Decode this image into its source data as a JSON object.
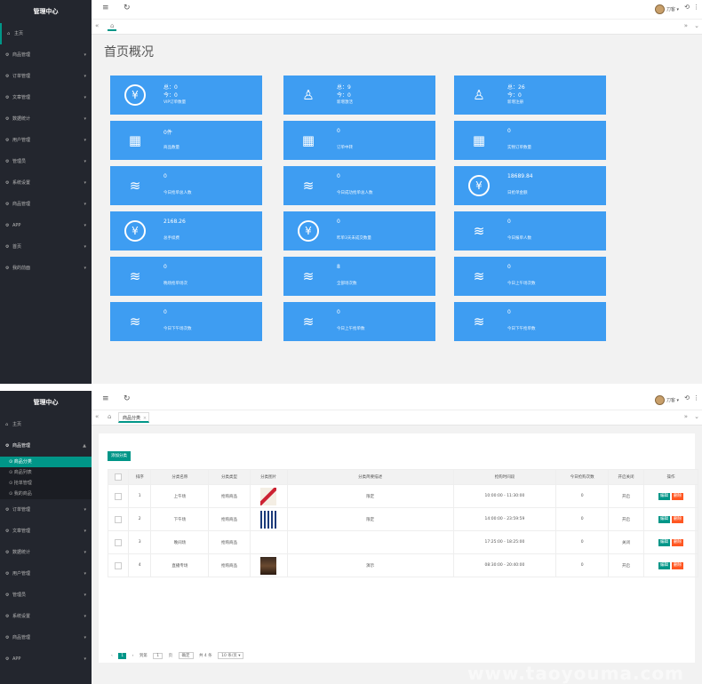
{
  "top_panel": {
    "sidebar_title": "管理中心",
    "menu": [
      {
        "icon": "home-icon",
        "glyph": "⌂",
        "label": "主页",
        "has_arrow": false
      },
      {
        "icon": "gear-icon",
        "glyph": "⚙",
        "label": "商品管理",
        "has_arrow": true
      },
      {
        "icon": "gear-icon",
        "glyph": "⚙",
        "label": "订单管理",
        "has_arrow": true
      },
      {
        "icon": "gear-icon",
        "glyph": "⚙",
        "label": "文章管理",
        "has_arrow": true
      },
      {
        "icon": "gear-icon",
        "glyph": "⚙",
        "label": "数据统计",
        "has_arrow": true
      },
      {
        "icon": "gear-icon",
        "glyph": "⚙",
        "label": "用户管理",
        "has_arrow": true
      },
      {
        "icon": "gear-icon",
        "glyph": "⚙",
        "label": "管理员",
        "has_arrow": true
      },
      {
        "icon": "gear-icon",
        "glyph": "⚙",
        "label": "系统设置",
        "has_arrow": true
      },
      {
        "icon": "gear-icon",
        "glyph": "⚙",
        "label": "商品管理",
        "has_arrow": true
      },
      {
        "icon": "gear-icon",
        "glyph": "⚙",
        "label": "APP",
        "has_arrow": true
      },
      {
        "icon": "gear-icon",
        "glyph": "⚙",
        "label": "首页",
        "has_arrow": true
      },
      {
        "icon": "gear-icon",
        "glyph": "⚙",
        "label": "我的前面",
        "has_arrow": true
      }
    ],
    "username": "刀客",
    "page_title": "首页概况",
    "cards": [
      {
        "icon": "yen-icon",
        "glyph": "¥",
        "circle": true,
        "l1": "总：0",
        "l2": "今：0",
        "l3": "VIP订单数量"
      },
      {
        "icon": "user-icon",
        "glyph": "♙",
        "circle": false,
        "l1": "总：9",
        "l2": "今：0",
        "l3": "新增激活"
      },
      {
        "icon": "user-icon",
        "glyph": "♙",
        "circle": false,
        "l1": "总：26",
        "l2": "今：0",
        "l3": "新增注册"
      },
      {
        "icon": "grid-icon",
        "glyph": "▦",
        "circle": false,
        "l1": "0件",
        "l2": "",
        "l3": "商品数量"
      },
      {
        "icon": "grid-icon",
        "glyph": "▦",
        "circle": false,
        "l1": "0",
        "l2": "",
        "l3": "订单中转"
      },
      {
        "icon": "grid-icon",
        "glyph": "▦",
        "circle": false,
        "l1": "0",
        "l2": "",
        "l3": "实物订单数量"
      },
      {
        "icon": "layers-icon",
        "glyph": "≋",
        "circle": false,
        "l1": "0",
        "l2": "",
        "l3": "今日抢单总人数"
      },
      {
        "icon": "layers-icon",
        "glyph": "≋",
        "circle": false,
        "l1": "0",
        "l2": "",
        "l3": "今日成功抢单总人数"
      },
      {
        "icon": "yen-icon",
        "glyph": "¥",
        "circle": true,
        "l1": "18689.84",
        "l2": "",
        "l3": "日抢单金额"
      },
      {
        "icon": "yen-icon",
        "glyph": "¥",
        "circle": true,
        "l1": "2168.26",
        "l2": "",
        "l3": "总手续费"
      },
      {
        "icon": "yen-icon",
        "glyph": "¥",
        "circle": true,
        "l1": "0",
        "l2": "",
        "l3": "昨单3天未成交数量"
      },
      {
        "icon": "layers-icon",
        "glyph": "≋",
        "circle": false,
        "l1": "0",
        "l2": "",
        "l3": "今日报单人数"
      },
      {
        "icon": "layers-icon",
        "glyph": "≋",
        "circle": false,
        "l1": "0",
        "l2": "",
        "l3": "晚场抢单场次"
      },
      {
        "icon": "layers-icon",
        "glyph": "≋",
        "circle": false,
        "l1": "8",
        "l2": "",
        "l3": "全部场次数"
      },
      {
        "icon": "layers-icon",
        "glyph": "≋",
        "circle": false,
        "l1": "0",
        "l2": "",
        "l3": "今日上午场次数"
      },
      {
        "icon": "layers-icon",
        "glyph": "≋",
        "circle": false,
        "l1": "0",
        "l2": "",
        "l3": "今日下午场次数"
      },
      {
        "icon": "layers-icon",
        "glyph": "≋",
        "circle": false,
        "l1": "0",
        "l2": "",
        "l3": "今日上午抢单数"
      },
      {
        "icon": "layers-icon",
        "glyph": "≋",
        "circle": false,
        "l1": "0",
        "l2": "",
        "l3": "今日下午抢单数"
      }
    ]
  },
  "bottom_panel": {
    "sidebar_title": "管理中心",
    "menu_home": "主页",
    "menu_open": "商品管理",
    "submenu": [
      {
        "label": "商品分类",
        "active": true
      },
      {
        "label": "商品列表",
        "active": false
      },
      {
        "label": "抢单管理",
        "active": false
      },
      {
        "label": "我的商品",
        "active": false
      }
    ],
    "menu_rest": [
      "订单管理",
      "文章管理",
      "数据统计",
      "用户管理",
      "管理员",
      "系统设置",
      "商品管理",
      "APP"
    ],
    "username": "刀客",
    "tab_label": "商品分类",
    "add_button": "添加分类",
    "columns": [
      "",
      "排序",
      "分类名称",
      "分类类型",
      "分类图片",
      "分类简要描述",
      "抢购时间段",
      "今日抢购次数",
      "开启关闭",
      "操作"
    ],
    "rows": [
      {
        "sort": "1",
        "name": "上午场",
        "type": "抢购商品",
        "has_image": true,
        "desc": "限定",
        "time": "10:00:00 - 11:30:00",
        "count": "0",
        "status": "开启",
        "ops": true
      },
      {
        "sort": "2",
        "name": "下午场",
        "type": "抢购商品",
        "has_image": true,
        "desc": "限定",
        "time": "14:00:00 - 23:59:59",
        "count": "0",
        "status": "开启",
        "ops": true
      },
      {
        "sort": "3",
        "name": "晚间场",
        "type": "抢购商品",
        "has_image": false,
        "desc": "",
        "time": "17:25:00 - 18:25:00",
        "count": "0",
        "status": "关闭",
        "ops": true
      },
      {
        "sort": "4",
        "name": "直播专场",
        "type": "抢购商品",
        "has_image": true,
        "desc": "演示",
        "time": "08:30:00 - 20:40:00",
        "count": "0",
        "status": "开启",
        "ops": true
      }
    ],
    "edit_label": "编辑",
    "delete_label": "删除",
    "pager": {
      "prev": "‹",
      "current": "1",
      "next": "›",
      "goto_label": "到第",
      "goto_value": "1",
      "page_unit": "页",
      "confirm": "确定",
      "total": "共 4 条",
      "page_size": "10 条/页 ▾"
    },
    "watermark": "www.taoyouma.com"
  },
  "colors": {
    "sidebar_bg": "#23262e",
    "accent": "#009688",
    "card_blue": "#3e9df2",
    "danger": "#ff5722"
  }
}
